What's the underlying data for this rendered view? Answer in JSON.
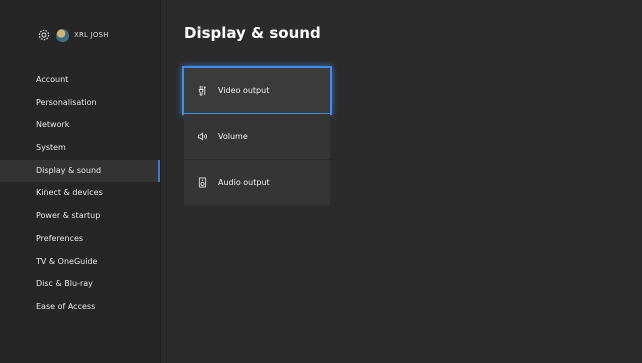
{
  "profile": {
    "settings_icon": "gear-icon",
    "gamertag": "XRL JOSH"
  },
  "sidebar": {
    "items": [
      {
        "label": "Account",
        "active": false
      },
      {
        "label": "Personalisation",
        "active": false
      },
      {
        "label": "Network",
        "active": false
      },
      {
        "label": "System",
        "active": false
      },
      {
        "label": "Display & sound",
        "active": true
      },
      {
        "label": "Kinect & devices",
        "active": false
      },
      {
        "label": "Power & startup",
        "active": false
      },
      {
        "label": "Preferences",
        "active": false
      },
      {
        "label": "TV & OneGuide",
        "active": false
      },
      {
        "label": "Disc & Blu-ray",
        "active": false
      },
      {
        "label": "Ease of Access",
        "active": false
      }
    ]
  },
  "main": {
    "title": "Display & sound",
    "options": [
      {
        "label": "Video output",
        "icon": "video-output-icon",
        "focused": true
      },
      {
        "label": "Volume",
        "icon": "volume-icon",
        "focused": false
      },
      {
        "label": "Audio output",
        "icon": "audio-output-icon",
        "focused": false
      }
    ]
  },
  "colors": {
    "background": "#2b2b2b",
    "accent": "#3f8cf2"
  }
}
